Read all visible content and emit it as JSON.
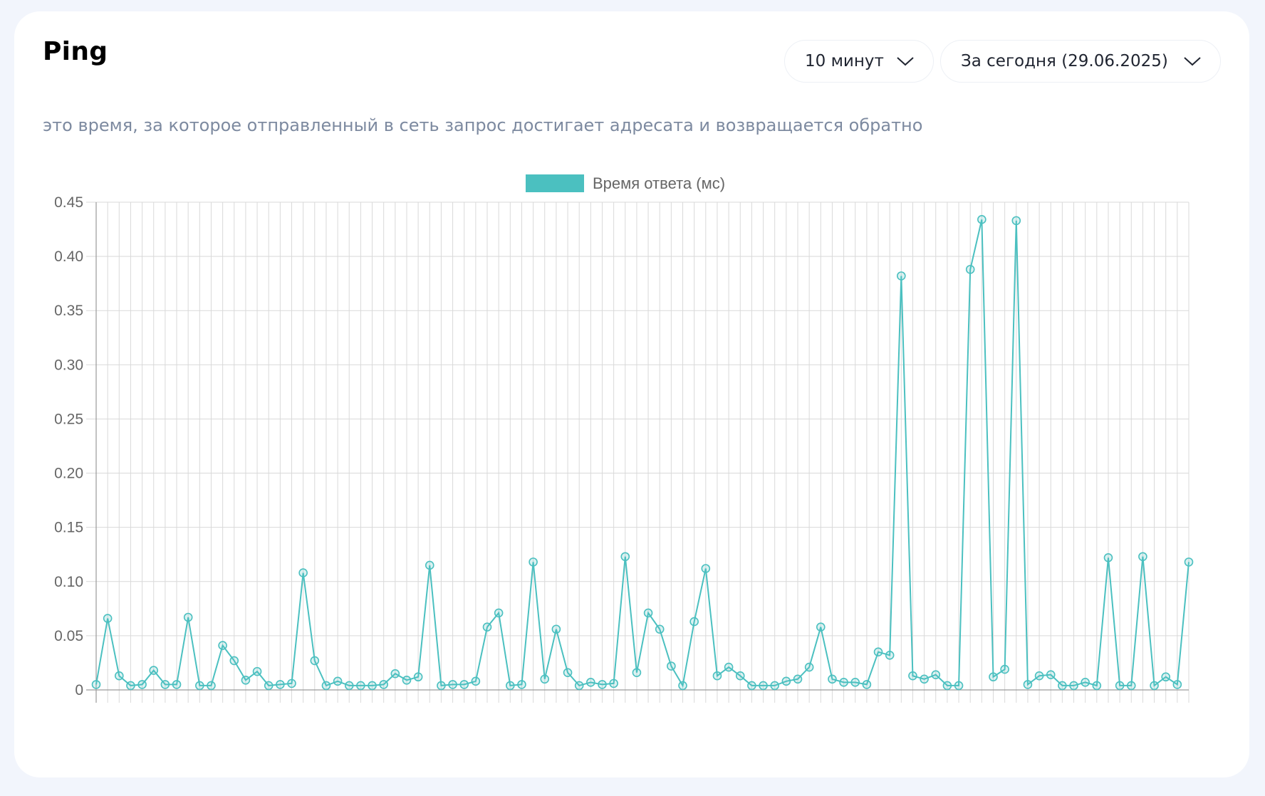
{
  "header": {
    "title": "Ping",
    "subtitle": "это время, за которое отправленный в сеть запрос достигает адресата и возвращается обратно"
  },
  "controls": {
    "interval_label": "10 минут",
    "period_label": "За сегодня (29.06.2025)"
  },
  "chart_data": {
    "type": "line",
    "title": "",
    "xlabel": "",
    "ylabel": "",
    "ylim": [
      0,
      0.45
    ],
    "yticks": [
      "0",
      "0.05",
      "0.10",
      "0.15",
      "0.20",
      "0.25",
      "0.30",
      "0.35",
      "0.40",
      "0.45"
    ],
    "ytick_values": [
      0,
      0.05,
      0.1,
      0.15,
      0.2,
      0.25,
      0.3,
      0.35,
      0.4,
      0.45
    ],
    "grid": true,
    "legend_position": "top-center",
    "series": [
      {
        "name": "Время ответа (мс)",
        "color": "#4bc0c0",
        "values": [
          0.005,
          0.066,
          0.013,
          0.004,
          0.005,
          0.018,
          0.005,
          0.005,
          0.067,
          0.004,
          0.004,
          0.041,
          0.027,
          0.009,
          0.017,
          0.004,
          0.005,
          0.006,
          0.108,
          0.027,
          0.004,
          0.008,
          0.004,
          0.004,
          0.004,
          0.005,
          0.015,
          0.009,
          0.012,
          0.115,
          0.004,
          0.005,
          0.005,
          0.008,
          0.058,
          0.071,
          0.004,
          0.005,
          0.118,
          0.01,
          0.056,
          0.016,
          0.004,
          0.007,
          0.005,
          0.006,
          0.123,
          0.016,
          0.071,
          0.056,
          0.022,
          0.004,
          0.063,
          0.112,
          0.013,
          0.021,
          0.013,
          0.004,
          0.004,
          0.004,
          0.008,
          0.01,
          0.021,
          0.058,
          0.01,
          0.007,
          0.007,
          0.005,
          0.035,
          0.032,
          0.382,
          0.013,
          0.01,
          0.014,
          0.004,
          0.004,
          0.388,
          0.434,
          0.012,
          0.019,
          0.433,
          0.005,
          0.013,
          0.014,
          0.004,
          0.004,
          0.007,
          0.004,
          0.122,
          0.004,
          0.004,
          0.123,
          0.004,
          0.012,
          0.005,
          0.118
        ]
      }
    ]
  }
}
